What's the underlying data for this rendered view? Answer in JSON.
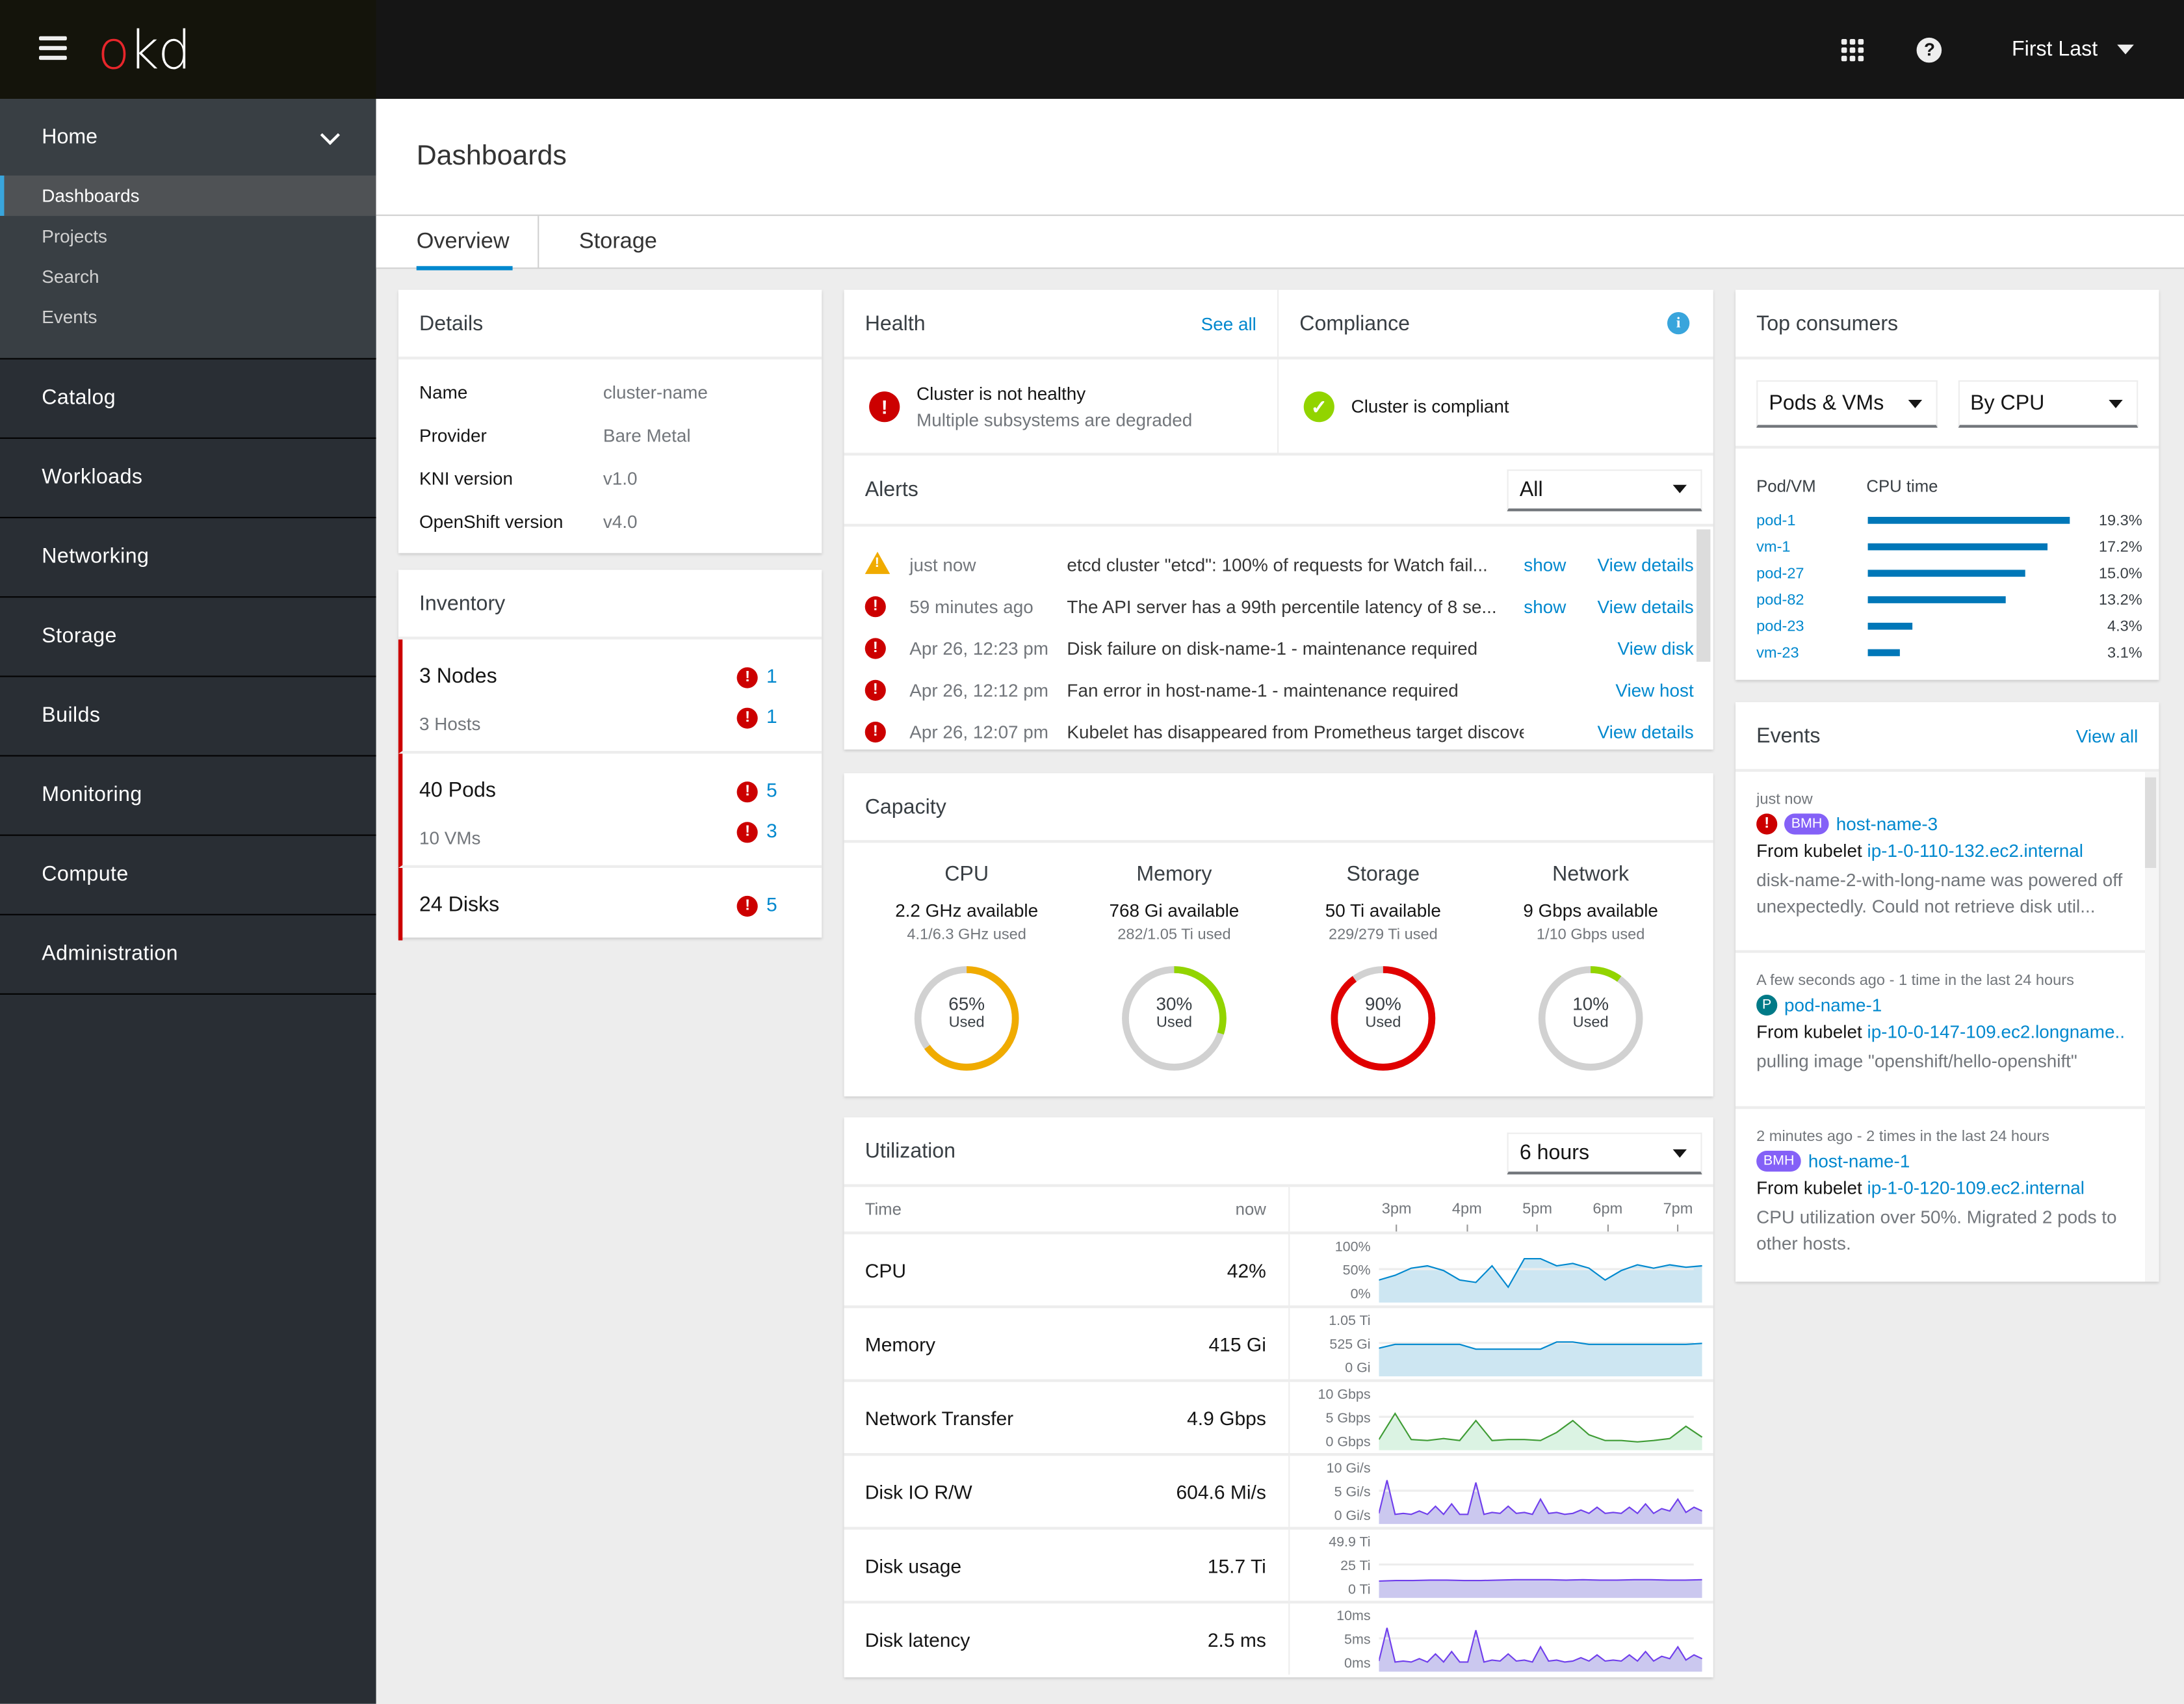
{
  "masthead": {
    "logo_o": "o",
    "logo_rest": "kd",
    "user_name": "First Last"
  },
  "sidebar": {
    "home": {
      "label": "Home",
      "items": [
        {
          "label": "Dashboards",
          "active": true
        },
        {
          "label": "Projects"
        },
        {
          "label": "Search"
        },
        {
          "label": "Events"
        }
      ]
    },
    "sections": [
      "Catalog",
      "Workloads",
      "Networking",
      "Storage",
      "Builds",
      "Monitoring",
      "Compute",
      "Administration"
    ]
  },
  "page": {
    "title": "Dashboards",
    "tabs": [
      {
        "label": "Overview",
        "active": true
      },
      {
        "label": "Storage"
      }
    ]
  },
  "details": {
    "title": "Details",
    "rows": [
      {
        "key": "Name",
        "value": "cluster-name"
      },
      {
        "key": "Provider",
        "value": "Bare Metal"
      },
      {
        "key": "KNI version",
        "value": "v1.0"
      },
      {
        "key": "OpenShift version",
        "value": "v4.0"
      }
    ]
  },
  "inventory": {
    "title": "Inventory",
    "groups": [
      {
        "main": "3 Nodes",
        "main_count": "1",
        "sub": "3 Hosts",
        "sub_count": "1"
      },
      {
        "main": "40 Pods",
        "main_count": "5",
        "sub": "10 VMs",
        "sub_count": "3"
      },
      {
        "main": "24 Disks",
        "main_count": "5"
      }
    ]
  },
  "health": {
    "title": "Health",
    "see_all": "See all",
    "status": "Cluster is not healthy",
    "detail": "Multiple subsystems are degraded"
  },
  "compliance": {
    "title": "Compliance",
    "status": "Cluster is compliant"
  },
  "alerts": {
    "title": "Alerts",
    "filter": "All",
    "items": [
      {
        "severity": "warning",
        "time": "just now",
        "message": "etcd cluster \"etcd\": 100% of requests for Watch fail...",
        "show": "show",
        "action": "View details"
      },
      {
        "severity": "error",
        "time": "59 minutes ago",
        "message": "The API server has a 99th percentile latency of 8 se...",
        "show": "show",
        "action": "View details"
      },
      {
        "severity": "error",
        "time": "Apr 26, 12:23 pm",
        "message": "Disk failure on disk-name-1 - maintenance required",
        "show": "",
        "action": "View disk"
      },
      {
        "severity": "error",
        "time": "Apr 26, 12:12 pm",
        "message": "Fan error in host-name-1 - maintenance required",
        "show": "",
        "action": "View host"
      },
      {
        "severity": "error",
        "time": "Apr 26, 12:07 pm",
        "message": "Kubelet has disappeared from Prometheus target discovery.",
        "show": "",
        "action": "View details"
      }
    ]
  },
  "capacity": {
    "title": "Capacity",
    "used_label": "Used",
    "items": [
      {
        "name": "CPU",
        "available": "2.2 GHz available",
        "used": "4.1/6.3 GHz used",
        "percent": 65,
        "color": "#f0ab00"
      },
      {
        "name": "Memory",
        "available": "768 Gi available",
        "used": "282/1.05 Ti used",
        "percent": 30,
        "color": "#92d400"
      },
      {
        "name": "Storage",
        "available": "50 Ti available",
        "used": "229/279 Ti used",
        "percent": 90,
        "color": "#e00000"
      },
      {
        "name": "Network",
        "available": "9 Gbps available",
        "used": "1/10 Gbps used",
        "percent": 10,
        "color": "#92d400"
      }
    ]
  },
  "utilization": {
    "title": "Utilization",
    "range": "6 hours",
    "col_time": "Time",
    "col_now": "now",
    "x_ticks": [
      "3pm",
      "4pm",
      "5pm",
      "6pm",
      "7pm"
    ],
    "rows": [
      {
        "name": "CPU",
        "value": "42%",
        "y_ticks": [
          "100%",
          "50%",
          "0%"
        ],
        "color": "#0088ce",
        "fill": "#cde6f2",
        "series": [
          0.3,
          0.4,
          0.55,
          0.6,
          0.5,
          0.3,
          0.25,
          0.6,
          0.15,
          0.75,
          0.75,
          0.6,
          0.65,
          0.55,
          0.3,
          0.5,
          0.62,
          0.55,
          0.62,
          0.57,
          0.6
        ]
      },
      {
        "name": "Memory",
        "value": "415 Gi",
        "y_ticks": [
          "1.05 Ti",
          "525 Gi",
          "0 Gi"
        ],
        "color": "#0088ce",
        "fill": "#cde6f2",
        "series": [
          0.42,
          0.5,
          0.5,
          0.5,
          0.5,
          0.5,
          0.4,
          0.4,
          0.4,
          0.4,
          0.4,
          0.55,
          0.55,
          0.5,
          0.5,
          0.5,
          0.5,
          0.5,
          0.5,
          0.5,
          0.52
        ]
      },
      {
        "name": "Network Transfer",
        "value": "4.9 Gbps",
        "y_ticks": [
          "10 Gbps",
          "5 Gbps",
          "0 Gbps"
        ],
        "color": "#3f9c35",
        "fill": "#dbf3e3",
        "series": [
          0.05,
          0.6,
          0.05,
          0.03,
          0.07,
          0.03,
          0.45,
          0.03,
          0.05,
          0.05,
          0.03,
          0.2,
          0.45,
          0.15,
          0.03,
          0.03,
          0.0,
          0.03,
          0.07,
          0.33,
          0.1
        ]
      },
      {
        "name": "Disk IO R/W",
        "value": "604.6 Mi/s",
        "y_ticks": [
          "10 Gi/s",
          "5 Gi/s",
          "0 Gi/s"
        ],
        "color": "#703fec",
        "fill": "#cbc8ef",
        "series": [
          0.05,
          0.75,
          0.03,
          0.05,
          0.03,
          0.1,
          0.03,
          0.2,
          0.03,
          0.25,
          0.03,
          0.03,
          0.7,
          0.03,
          0.07,
          0.05,
          0.2,
          0.05,
          0.07,
          0.03,
          0.35,
          0.05,
          0.07,
          0.03,
          0.05,
          0.12,
          0.05,
          0.18,
          0.05,
          0.07,
          0.05,
          0.18,
          0.05,
          0.25,
          0.05,
          0.15,
          0.1,
          0.35,
          0.07,
          0.18,
          0.1
        ]
      },
      {
        "name": "Disk usage",
        "value": "15.7 Ti",
        "y_ticks": [
          "49.9 Ti",
          "25 Ti",
          "0 Ti"
        ],
        "color": "#703fec",
        "fill": "#cbc8ef",
        "series": [
          0.18,
          0.19,
          0.19,
          0.2,
          0.2,
          0.19,
          0.19,
          0.2,
          0.21,
          0.21,
          0.21,
          0.2,
          0.21,
          0.2,
          0.2,
          0.21,
          0.21,
          0.2,
          0.2,
          0.21
        ]
      },
      {
        "name": "Disk latency",
        "value": "2.5 ms",
        "y_ticks": [
          "10ms",
          "5ms",
          "0ms"
        ],
        "color": "#703fec",
        "fill": "#cbc8ef",
        "series": [
          0.05,
          0.75,
          0.03,
          0.05,
          0.03,
          0.1,
          0.03,
          0.2,
          0.03,
          0.25,
          0.03,
          0.03,
          0.7,
          0.03,
          0.07,
          0.05,
          0.2,
          0.05,
          0.07,
          0.03,
          0.35,
          0.05,
          0.07,
          0.03,
          0.05,
          0.12,
          0.05,
          0.18,
          0.05,
          0.07,
          0.05,
          0.18,
          0.05,
          0.25,
          0.05,
          0.15,
          0.1,
          0.35,
          0.07,
          0.18,
          0.1
        ]
      }
    ]
  },
  "top_consumers": {
    "title": "Top consumers",
    "type_select": "Pods & VMs",
    "metric_select": "By CPU",
    "col_name": "Pod/VM",
    "col_metric": "CPU time",
    "max": 19.3,
    "items": [
      {
        "name": "pod-1",
        "value": 19.3,
        "label": "19.3%"
      },
      {
        "name": "vm-1",
        "value": 17.2,
        "label": "17.2%"
      },
      {
        "name": "pod-27",
        "value": 15.0,
        "label": "15.0%"
      },
      {
        "name": "pod-82",
        "value": 13.2,
        "label": "13.2%"
      },
      {
        "name": "pod-23",
        "value": 4.3,
        "label": "4.3%"
      },
      {
        "name": "vm-23",
        "value": 3.1,
        "label": "3.1%"
      }
    ]
  },
  "events": {
    "title": "Events",
    "view_all": "View all",
    "items": [
      {
        "time": "just now",
        "error": true,
        "kind": "BMH",
        "name": "host-name-3",
        "from_label": "From kubelet",
        "from": "ip-1-0-110-132.ec2.internal",
        "desc": "disk-name-2-with-long-name was powered off unexpectedly. Could not retrieve disk util..."
      },
      {
        "time": "A few seconds ago - 1 time in the last 24 hours",
        "error": false,
        "kind": "P",
        "name": "pod-name-1",
        "from_label": "From kubelet",
        "from": "ip-10-0-147-109.ec2.longname...",
        "desc": "pulling image \"openshift/hello-openshift\""
      },
      {
        "time": "2 minutes ago - 2 times in the last 24 hours",
        "error": false,
        "kind": "BMH",
        "name": "host-name-1",
        "from_label": "From kubelet",
        "from": "ip-1-0-120-109.ec2.internal",
        "desc": "CPU utilization over 50%. Migrated 2 pods to other hosts."
      }
    ]
  }
}
